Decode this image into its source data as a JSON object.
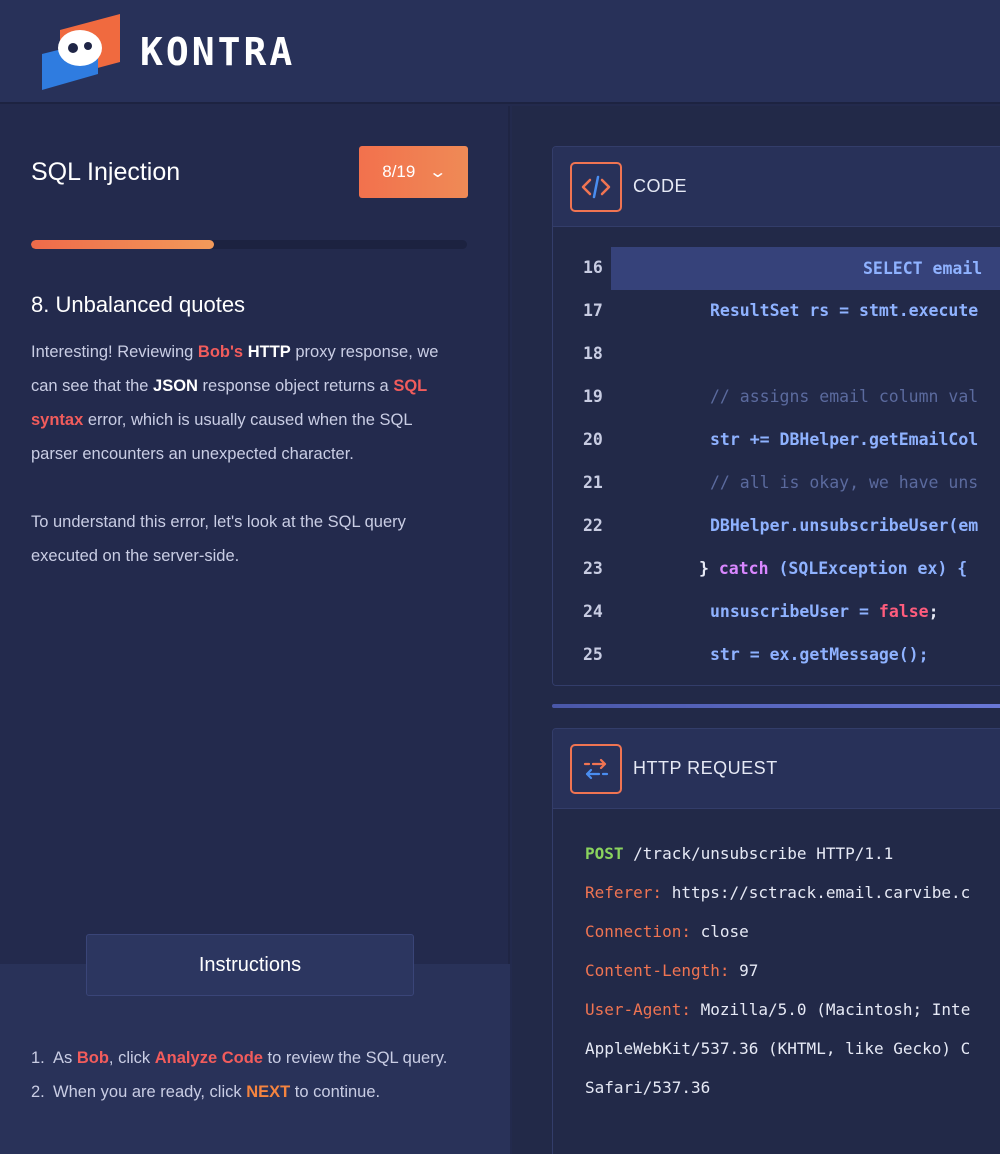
{
  "header": {
    "brand": "KONTRA"
  },
  "left": {
    "module_title": "SQL Injection",
    "step_selector": "8/19",
    "progress": 0.42,
    "step_heading": "8. Unbalanced quotes",
    "desc1": {
      "a": "Interesting! Reviewing ",
      "bob": "Bob's",
      "b": " ",
      "http": "HTTP",
      "c": " proxy response, we can see that the ",
      "json": "JSON",
      "d": " response object returns a ",
      "sql_syntax": "SQL syntax",
      "e": " error, which is usually caused when the SQL parser encounters an unexpected character."
    },
    "desc2": "To understand this error, let's look at the SQL query executed on the server-side.",
    "instructions_tab": "Instructions",
    "instructions": {
      "i1_num": "1.",
      "i1_a": "As ",
      "i1_bob": "Bob",
      "i1_b": ", click ",
      "i1_analyze": "Analyze Code",
      "i1_c": " to review the SQL query.",
      "i2_num": "2.",
      "i2_a": "When you are ready, click ",
      "i2_next": "NEXT",
      "i2_b": " to continue."
    }
  },
  "code_panel": {
    "title": "CODE",
    "lines": [
      {
        "n": "16",
        "text": "SELECT email"
      },
      {
        "n": "17",
        "text": "ResultSet rs = stmt.execute"
      },
      {
        "n": "18",
        "text": ""
      },
      {
        "n": "19",
        "text": "// assigns email column val"
      },
      {
        "n": "20",
        "text": "str += DBHelper.getEmailCol"
      },
      {
        "n": "21",
        "text": "// all is okay, we have uns"
      },
      {
        "n": "22",
        "text": "DBHelper.unsubscribeUser(em"
      },
      {
        "n": "23a",
        "text": "} "
      },
      {
        "n": "23b",
        "text": "catch"
      },
      {
        "n": "23c",
        "text": " (SQLException ex) {"
      },
      {
        "n": "24a",
        "text": "unsuscribeUser = "
      },
      {
        "n": "24b",
        "text": "false"
      },
      {
        "n": "24c",
        "text": ";"
      },
      {
        "n": "25",
        "text": "str = ex.getMessage();"
      }
    ],
    "numbers": [
      "16",
      "17",
      "18",
      "19",
      "20",
      "21",
      "22",
      "23",
      "24",
      "25"
    ]
  },
  "http_panel": {
    "title": "HTTP REQUEST",
    "verb": "POST",
    "request_line": " /track/unsubscribe HTTP/1.1",
    "headers": [
      {
        "key": "Referer:",
        "value": " https://sctrack.email.carvibe.c"
      },
      {
        "key": "Connection:",
        "value": " close"
      },
      {
        "key": "Content-Length:",
        "value": " 97"
      },
      {
        "key": "User-Agent:",
        "value": " Mozilla/5.0 (Macintosh; Inte"
      }
    ],
    "ua_cont1": "AppleWebKit/537.36 (KHTML, like Gecko) C",
    "ua_cont2": "Safari/537.36"
  }
}
